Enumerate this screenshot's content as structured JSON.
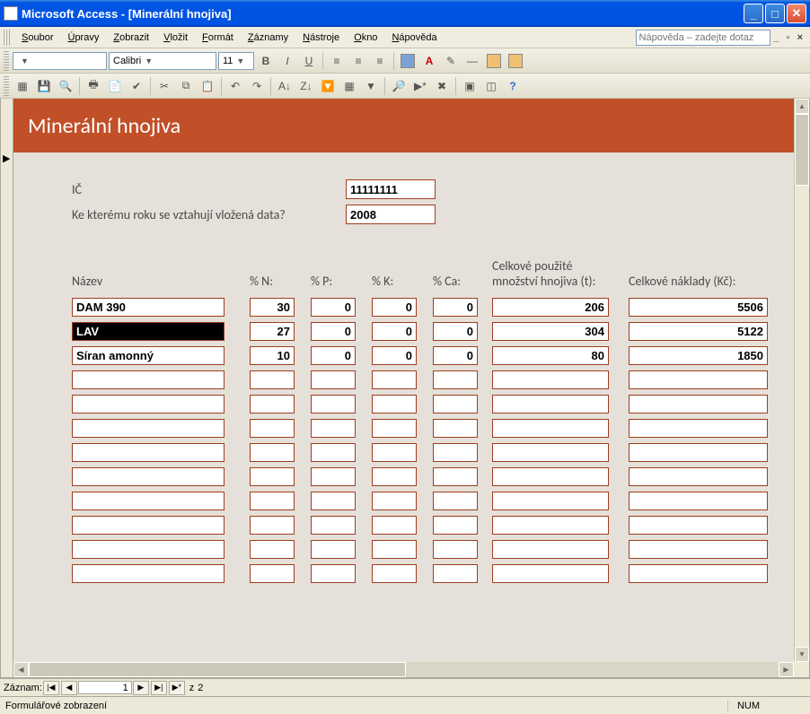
{
  "titlebar": {
    "text": "Microsoft Access - [Minerální hnojiva]"
  },
  "menus": [
    "Soubor",
    "Úpravy",
    "Zobrazit",
    "Vložit",
    "Formát",
    "Záznamy",
    "Nástroje",
    "Okno",
    "Nápověda"
  ],
  "help_placeholder": "Nápověda – zadejte dotaz",
  "format_toolbar": {
    "font": "Calibri",
    "size": "11"
  },
  "header_title": "Minerální hnojiva",
  "labels": {
    "ic": "IČ",
    "year": "Ke kterému roku se vztahují vložená data?",
    "name": "Název",
    "n": "% N:",
    "p": "% P:",
    "k": "% K:",
    "ca": "% Ca:",
    "qty": "Celkové použité množství hnojiva (t):",
    "cost": "Celkové náklady (Kč):"
  },
  "top": {
    "ic": "11111111",
    "year": "2008"
  },
  "rows": [
    {
      "name": "DAM 390",
      "n": "30",
      "p": "0",
      "k": "0",
      "ca": "0",
      "qty": "206",
      "cost": "5506"
    },
    {
      "name": "LAV",
      "n": "27",
      "p": "0",
      "k": "0",
      "ca": "0",
      "qty": "304",
      "cost": "5122",
      "selected": true
    },
    {
      "name": "Síran amonný",
      "n": "10",
      "p": "0",
      "k": "0",
      "ca": "0",
      "qty": "80",
      "cost": "1850"
    },
    {
      "name": "",
      "n": "",
      "p": "",
      "k": "",
      "ca": "",
      "qty": "",
      "cost": ""
    },
    {
      "name": "",
      "n": "",
      "p": "",
      "k": "",
      "ca": "",
      "qty": "",
      "cost": ""
    },
    {
      "name": "",
      "n": "",
      "p": "",
      "k": "",
      "ca": "",
      "qty": "",
      "cost": ""
    },
    {
      "name": "",
      "n": "",
      "p": "",
      "k": "",
      "ca": "",
      "qty": "",
      "cost": ""
    },
    {
      "name": "",
      "n": "",
      "p": "",
      "k": "",
      "ca": "",
      "qty": "",
      "cost": ""
    },
    {
      "name": "",
      "n": "",
      "p": "",
      "k": "",
      "ca": "",
      "qty": "",
      "cost": ""
    },
    {
      "name": "",
      "n": "",
      "p": "",
      "k": "",
      "ca": "",
      "qty": "",
      "cost": ""
    },
    {
      "name": "",
      "n": "",
      "p": "",
      "k": "",
      "ca": "",
      "qty": "",
      "cost": ""
    },
    {
      "name": "",
      "n": "",
      "p": "",
      "k": "",
      "ca": "",
      "qty": "",
      "cost": ""
    }
  ],
  "recnav": {
    "label": "Záznam:",
    "current": "1",
    "of_label": "z",
    "total": "2"
  },
  "status": {
    "text": "Formulářové zobrazení",
    "num": "NUM"
  }
}
